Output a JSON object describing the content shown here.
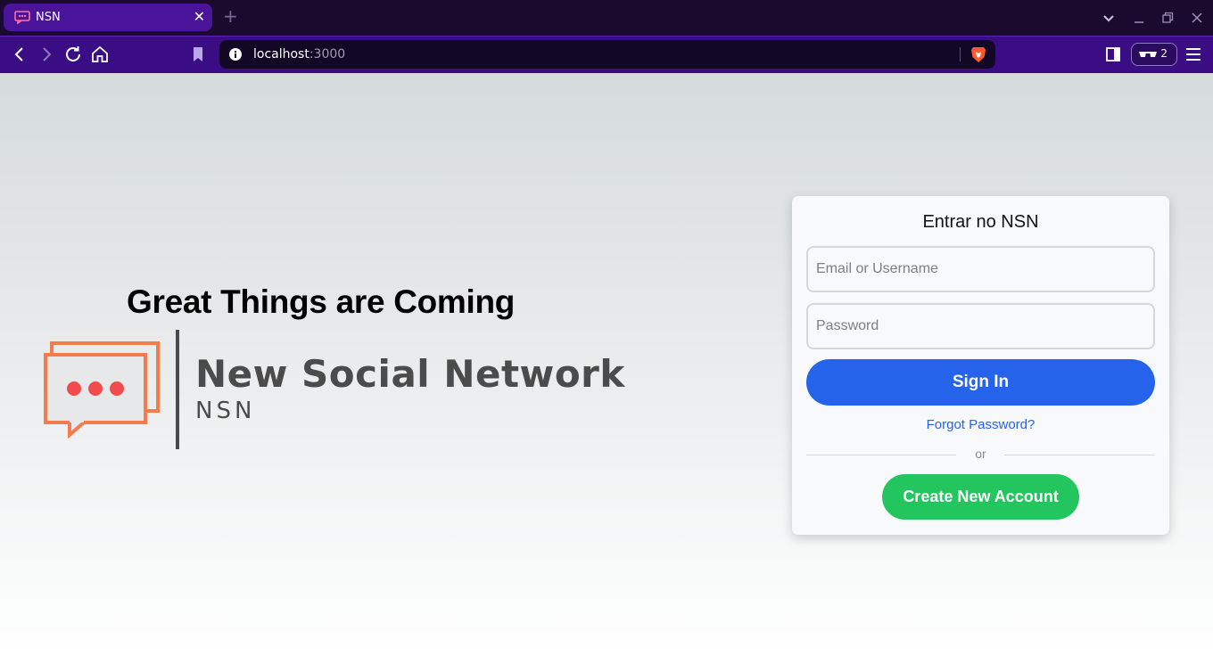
{
  "browser": {
    "tab": {
      "title": "NSN",
      "close_glyph": "✕"
    },
    "new_tab_glyph": "+",
    "url": {
      "host": "localhost",
      "port": ":3000"
    },
    "wallet_count": "2",
    "icons": [
      "chat-bubble-icon",
      "chevron-down-icon",
      "minimize-icon",
      "restore-icon",
      "close-icon",
      "back-icon",
      "forward-icon",
      "reload-icon",
      "home-icon",
      "bookmark-icon",
      "info-icon",
      "brave-shield-icon",
      "sidebar-icon",
      "wallet-icon",
      "menu-icon"
    ]
  },
  "page": {
    "hero_heading": "Great Things are Coming",
    "brand_name": "New Social Network",
    "brand_abbr": "NSN",
    "login": {
      "title": "Entrar no NSN",
      "email_placeholder": "Email or Username",
      "password_placeholder": "Password",
      "signin_label": "Sign In",
      "forgot_label": "Forgot Password?",
      "divider_text": "or",
      "create_label": "Create New Account"
    }
  },
  "colors": {
    "primary_blue": "#2563eb",
    "success_green": "#22c55e",
    "logo_orange": "#f47c4c",
    "logo_dot_red": "#f24b4b",
    "tab_purple": "#4a149a",
    "toolbar_purple": "#3a0d84"
  }
}
